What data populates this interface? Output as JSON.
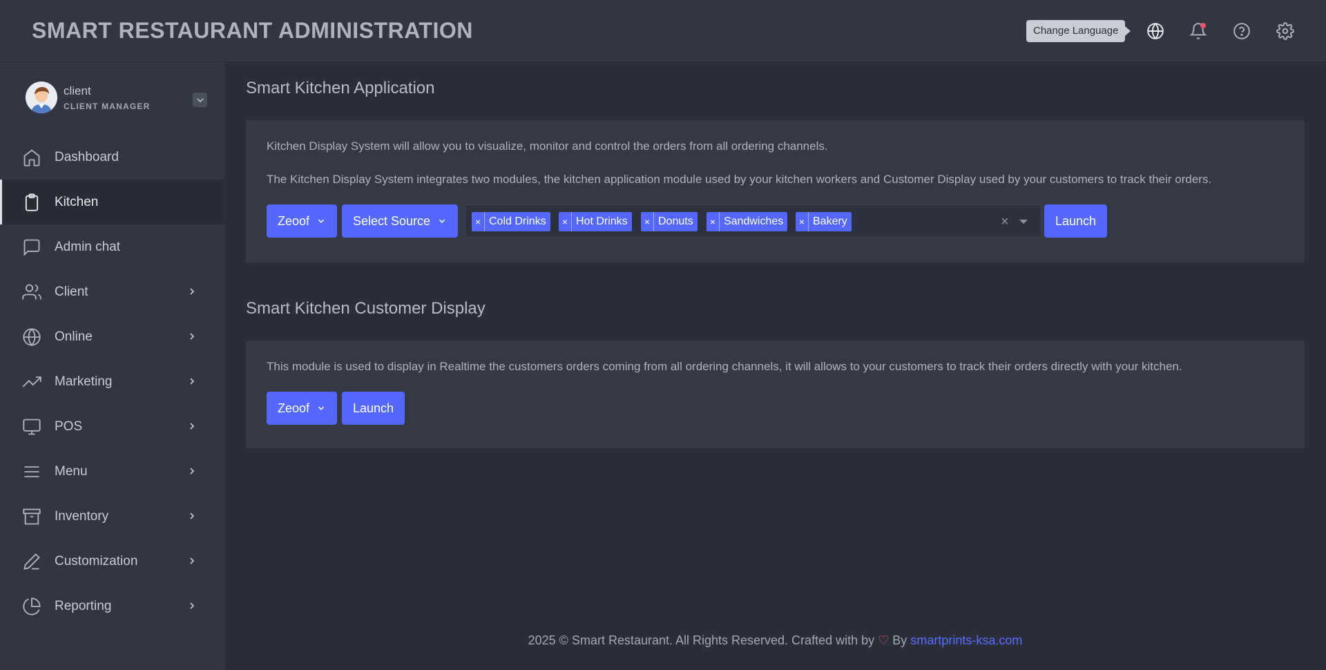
{
  "header": {
    "title": "SMART RESTAURANT ADMINISTRATION",
    "tooltip": "Change Language",
    "icons": [
      "globe-icon",
      "bell-icon",
      "help-icon",
      "gear-icon"
    ]
  },
  "user": {
    "name": "client",
    "role": "CLIENT MANAGER"
  },
  "sidebar": {
    "items": [
      {
        "label": "Dashboard",
        "icon": "home-icon",
        "active": false,
        "has_children": false
      },
      {
        "label": "Kitchen",
        "icon": "clipboard-icon",
        "active": true,
        "has_children": false
      },
      {
        "label": "Admin chat",
        "icon": "chat-icon",
        "active": false,
        "has_children": false
      },
      {
        "label": "Client",
        "icon": "users-icon",
        "active": false,
        "has_children": true
      },
      {
        "label": "Online",
        "icon": "globe-icon",
        "active": false,
        "has_children": true
      },
      {
        "label": "Marketing",
        "icon": "trending-icon",
        "active": false,
        "has_children": true
      },
      {
        "label": "POS",
        "icon": "monitor-icon",
        "active": false,
        "has_children": true
      },
      {
        "label": "Menu",
        "icon": "menu-icon",
        "active": false,
        "has_children": true
      },
      {
        "label": "Inventory",
        "icon": "archive-icon",
        "active": false,
        "has_children": true
      },
      {
        "label": "Customization",
        "icon": "pen-icon",
        "active": false,
        "has_children": true
      },
      {
        "label": "Reporting",
        "icon": "pie-chart-icon",
        "active": false,
        "has_children": true
      }
    ]
  },
  "kitchen_app": {
    "title": "Smart Kitchen Application",
    "desc1": "Kitchen Display System will allow you to visualize, monitor and control the orders from all ordering channels.",
    "desc2": "The Kitchen Display System integrates two modules, the kitchen application module used by your kitchen workers and Customer Display used by your customers to track their orders.",
    "store_select": "Zeoof",
    "source_select": "Select Source",
    "tags": [
      "Cold Drinks",
      "Hot Drinks",
      "Donuts",
      "Sandwiches",
      "Bakery"
    ],
    "tag_remove": "×",
    "clear": "×",
    "launch": "Launch"
  },
  "customer_display": {
    "title": "Smart Kitchen Customer Display",
    "desc": "This module is used to display in Realtime the customers orders coming from all ordering channels, it will allows to your customers to track their orders directly with your kitchen.",
    "store_select": "Zeoof",
    "launch": "Launch"
  },
  "footer": {
    "text": "2025 © Smart Restaurant. All Rights Reserved. Crafted with by",
    "heart": "♡",
    "by": "By",
    "link": "smartprints-ksa.com"
  },
  "colors": {
    "accent": "#5468ff",
    "background": "#2a2e39",
    "panel": "#323643",
    "notification": "#f0506e"
  }
}
